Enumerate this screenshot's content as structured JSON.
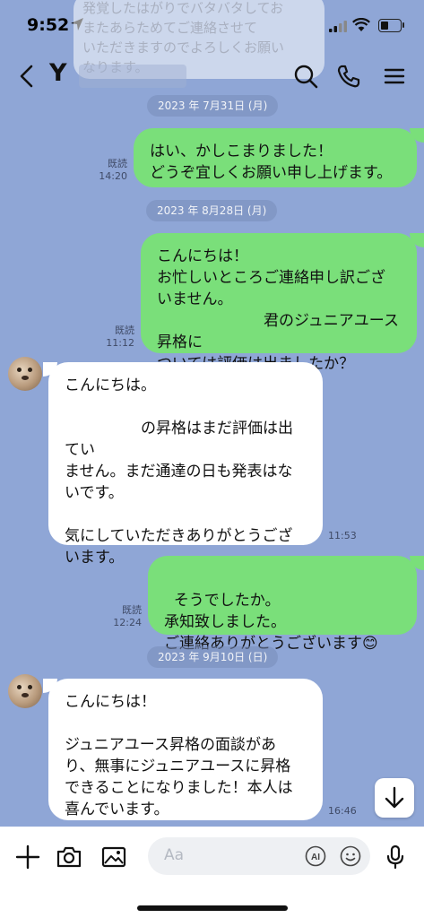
{
  "status": {
    "time": "9:52"
  },
  "ghost_message": "発覚したはがりでバタバタしてお\nまたあらためてご連絡させて\nいただきますのでよろしくお願い\nなります。",
  "header": {
    "contact_name": "Y"
  },
  "messages": [
    {
      "date": "2023 年 7月31日 (月)"
    },
    {
      "text": "はい、かしこまりました！\nどうぞ宜しくお願い申し上げます。",
      "read": "既読",
      "time": "14:20"
    },
    {
      "date": "2023 年 8月28日 (月)"
    },
    {
      "text": "こんにちは！\nお忙しいところご連絡申し訳ござ\nいません。\n　　　　　　　君のジュニアユース昇格に\nついては評価は出ましたか？",
      "read": "既読",
      "time": "11:12"
    },
    {
      "text": "こんにちは。\n\n　　　　　の昇格はまだ評価は出てい\nません。まだ通達の日も発表はな\nいです。\n\n気にしていただきありがとうござ\nいます。",
      "time": "11:53"
    },
    {
      "text": "そうでしたか。\n承知致しました。\nご連絡ありがとうございます",
      "emoji": "😊",
      "read": "既読",
      "time": "12:24"
    },
    {
      "date": "2023 年 9月10日 (日)"
    },
    {
      "text": "こんにちは！\n\nジュニアユース昇格の面談があ\nり、無事にジュニアユースに昇格\nできることになりました！本人は\n喜んでいます。",
      "time": "16:46"
    }
  ],
  "composer": {
    "placeholder": "Aa",
    "ai_label": "AI"
  }
}
